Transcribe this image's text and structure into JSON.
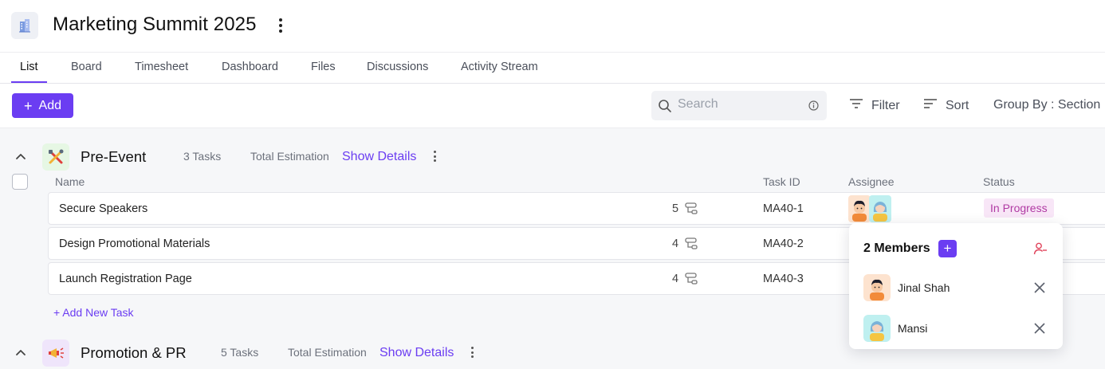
{
  "project": {
    "title": "Marketing Summit 2025",
    "icon": "building-icon"
  },
  "tabs": [
    "List",
    "Board",
    "Timesheet",
    "Dashboard",
    "Files",
    "Discussions",
    "Activity Stream"
  ],
  "toolbar": {
    "add_label": "Add",
    "search_placeholder": "Search",
    "filter_label": "Filter",
    "sort_label": "Sort",
    "group_label": "Group By : Section"
  },
  "columns": {
    "name": "Name",
    "task_id": "Task ID",
    "assignee": "Assignee",
    "status": "Status"
  },
  "sections": [
    {
      "title": "Pre-Event",
      "icon": "tools-icon",
      "count": "3 Tasks",
      "estimation": "Total Estimation",
      "show_details": "Show Details",
      "tasks": [
        {
          "name": "Secure Speakers",
          "subtasks": "5",
          "id": "MA40-1",
          "status": "In Progress"
        },
        {
          "name": "Design Promotional Materials",
          "subtasks": "4",
          "id": "MA40-2"
        },
        {
          "name": "Launch Registration Page",
          "subtasks": "4",
          "id": "MA40-3"
        }
      ],
      "add_task": "+ Add New Task"
    },
    {
      "title": "Promotion & PR",
      "icon": "megaphone-icon",
      "count": "5 Tasks",
      "estimation": "Total Estimation",
      "show_details": "Show Details"
    }
  ],
  "members_popover": {
    "title": "2 Members",
    "members": [
      {
        "name": "Jinal Shah",
        "bg": "#fde3cf"
      },
      {
        "name": "Mansi",
        "bg": "#bff0f0"
      }
    ]
  },
  "colors": {
    "accent": "#6b3df2",
    "status_bg": "#f8e6f7",
    "status_text": "#b03aa3",
    "danger": "#e0435b"
  }
}
